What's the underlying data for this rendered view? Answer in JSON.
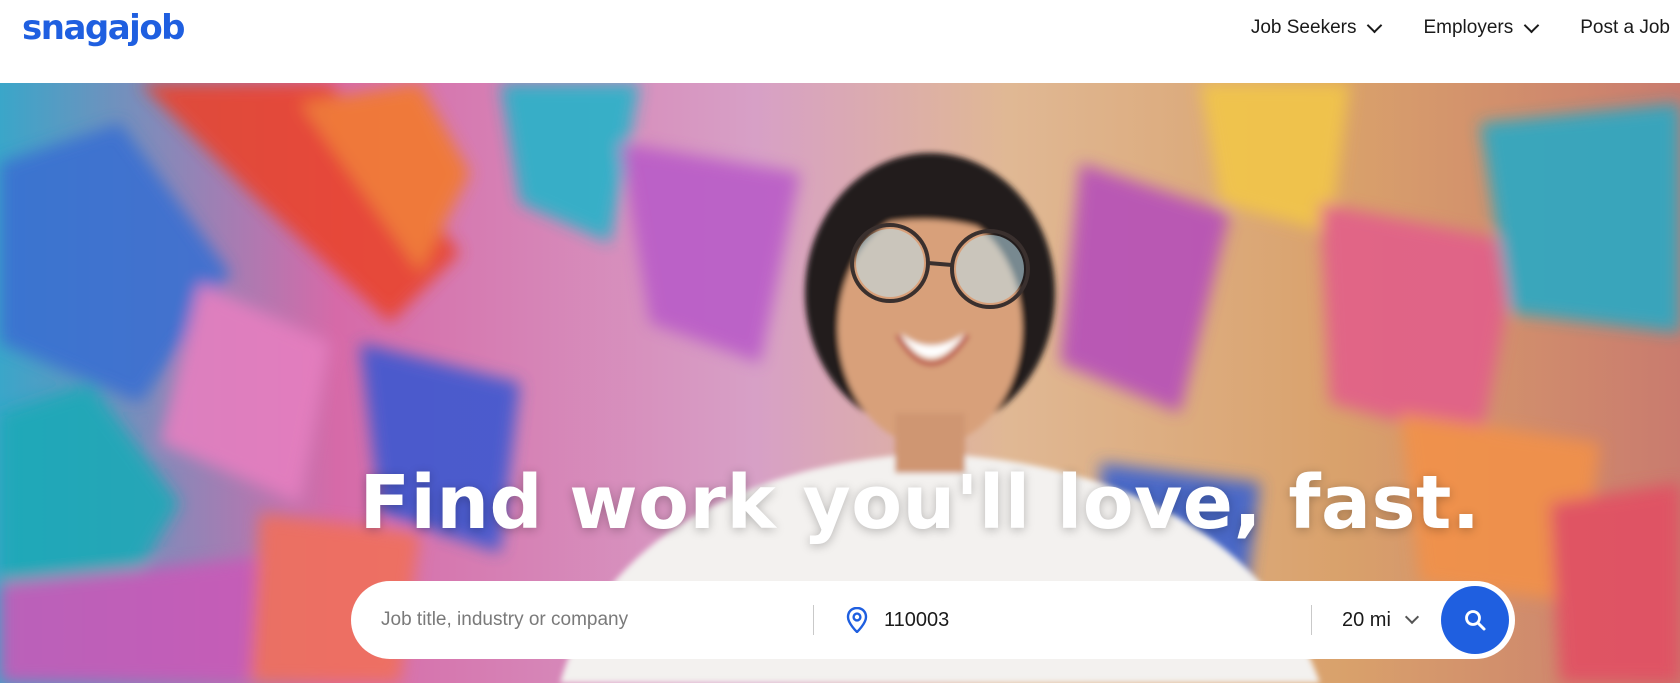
{
  "header": {
    "logo_text": "snagajob",
    "nav": [
      {
        "label": "Job Seekers",
        "has_dropdown": true
      },
      {
        "label": "Employers",
        "has_dropdown": true
      },
      {
        "label": "Post a Job",
        "has_dropdown": false
      }
    ]
  },
  "hero": {
    "headline": "Find work you'll love, fast.",
    "search": {
      "what_placeholder": "Job title, industry or company",
      "what_value": "",
      "where_value": "110003",
      "radius_value": "20 mi",
      "location_icon": "location-pin-icon",
      "search_icon": "magnifier-icon"
    }
  },
  "colors": {
    "brand": "#1f5fe0",
    "text": "#1a1a1a",
    "placeholder": "#7a7a7a",
    "white": "#ffffff"
  }
}
